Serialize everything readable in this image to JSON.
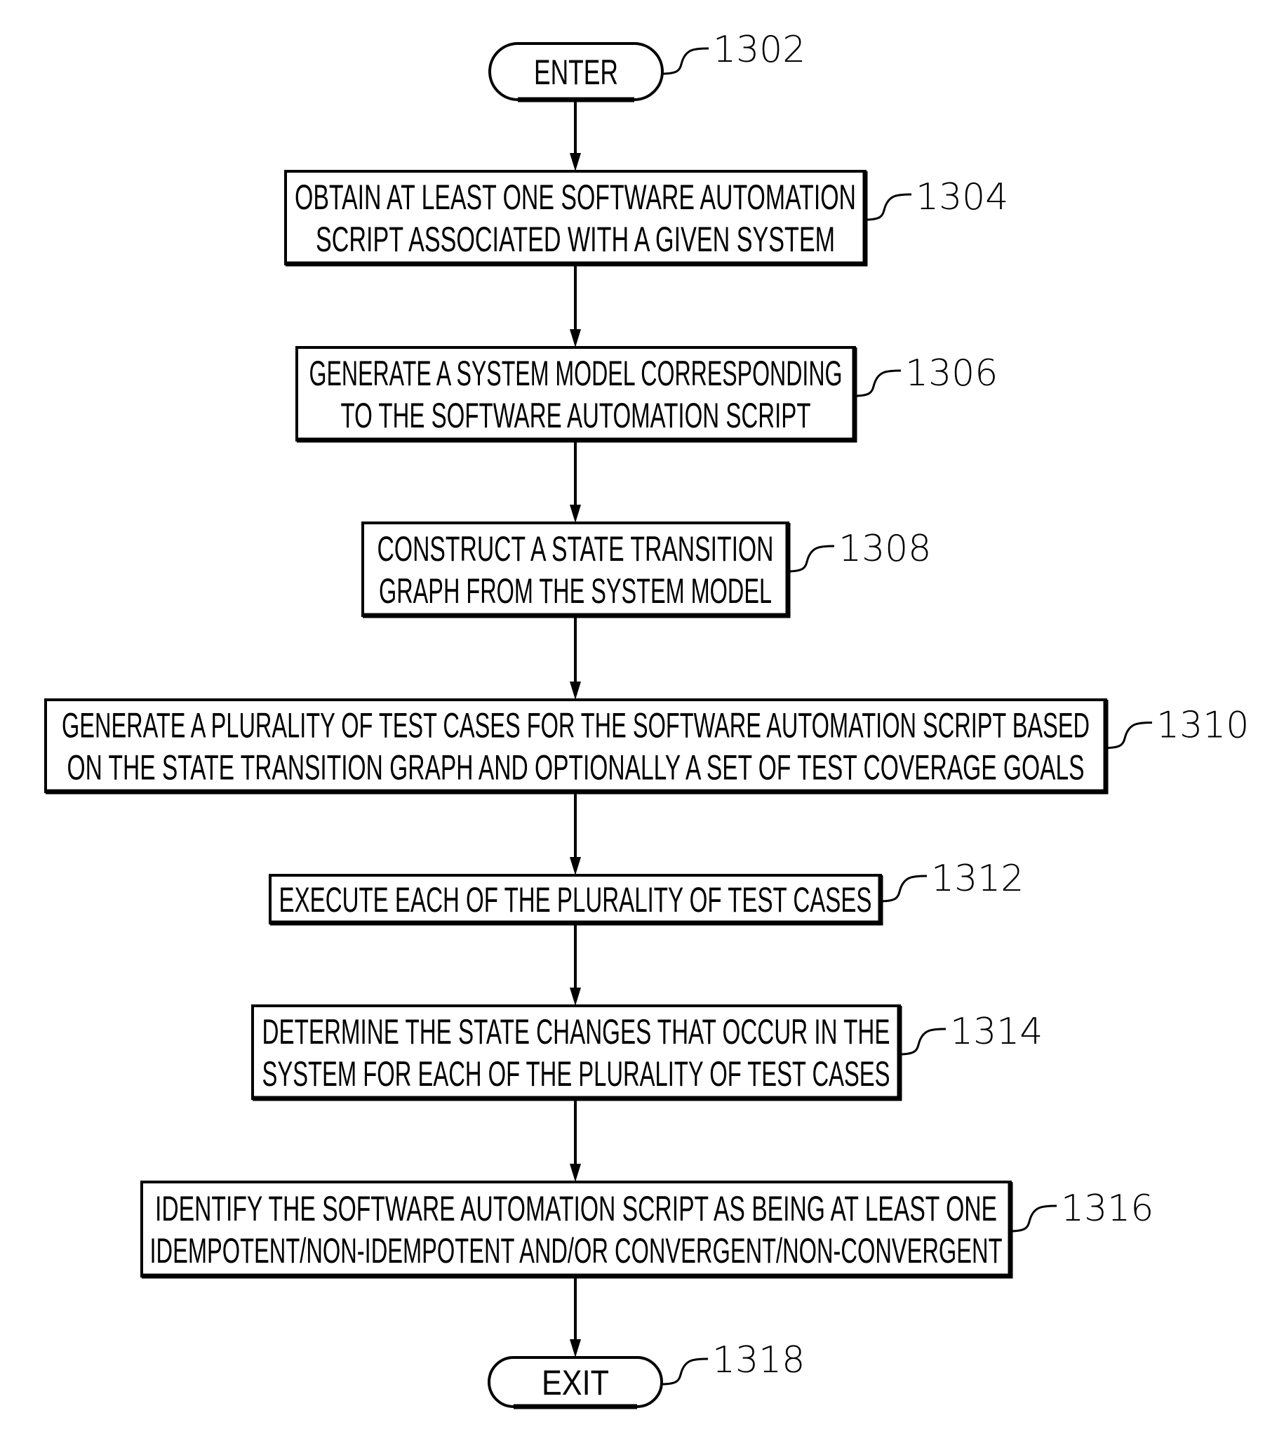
{
  "diagram": {
    "type": "flowchart",
    "start": {
      "label": "ENTER",
      "ref": "1302"
    },
    "steps": [
      {
        "ref": "1304",
        "lines": [
          "OBTAIN AT LEAST ONE SOFTWARE AUTOMATION",
          "SCRIPT ASSOCIATED WITH A GIVEN SYSTEM"
        ]
      },
      {
        "ref": "1306",
        "lines": [
          "GENERATE A SYSTEM MODEL CORRESPONDING",
          "TO THE SOFTWARE AUTOMATION SCRIPT"
        ]
      },
      {
        "ref": "1308",
        "lines": [
          "CONSTRUCT A STATE TRANSITION",
          "GRAPH FROM THE SYSTEM MODEL"
        ]
      },
      {
        "ref": "1310",
        "lines": [
          "GENERATE A PLURALITY OF TEST CASES FOR THE SOFTWARE AUTOMATION SCRIPT BASED",
          "ON THE STATE TRANSITION GRAPH AND OPTIONALLY A SET OF TEST COVERAGE GOALS"
        ]
      },
      {
        "ref": "1312",
        "lines": [
          "EXECUTE EACH OF THE PLURALITY OF TEST CASES"
        ]
      },
      {
        "ref": "1314",
        "lines": [
          "DETERMINE THE STATE CHANGES THAT OCCUR IN THE",
          "SYSTEM FOR EACH OF THE PLURALITY OF TEST CASES"
        ]
      },
      {
        "ref": "1316",
        "lines": [
          "IDENTIFY THE SOFTWARE AUTOMATION SCRIPT AS BEING AT LEAST ONE",
          "IDEMPOTENT/NON-IDEMPOTENT AND/OR CONVERGENT/NON-CONVERGENT"
        ]
      }
    ],
    "end": {
      "label": "EXIT",
      "ref": "1318"
    }
  }
}
